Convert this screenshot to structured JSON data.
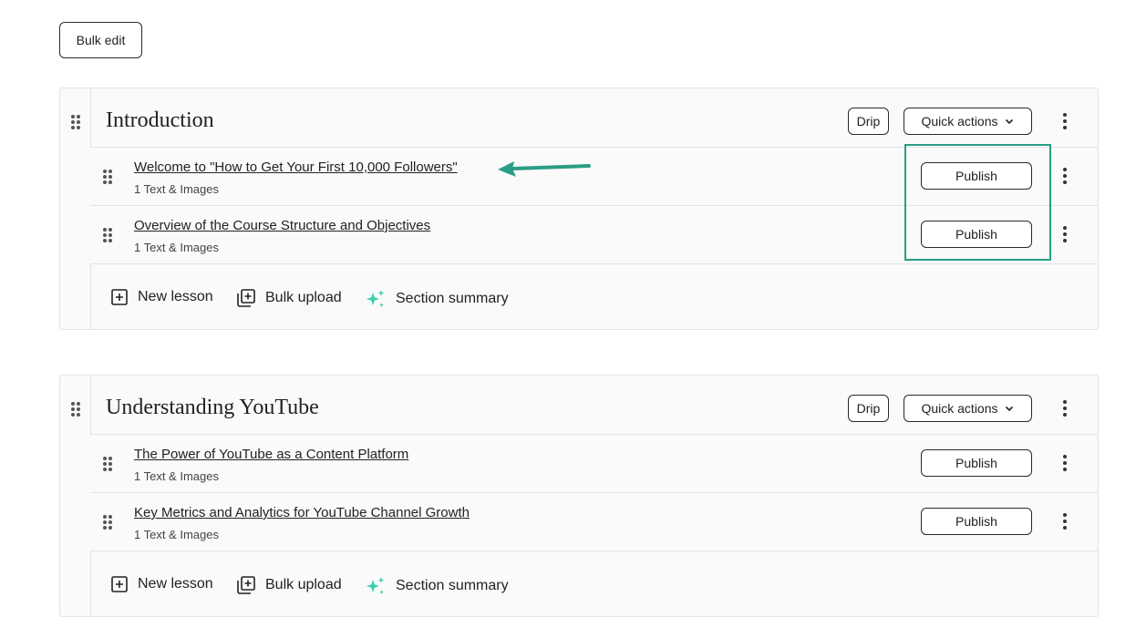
{
  "toolbar": {
    "bulk_edit_label": "Bulk edit"
  },
  "sections": [
    {
      "title": "Introduction",
      "drip_label": "Drip",
      "quick_actions_label": "Quick actions",
      "lessons": [
        {
          "title": "Welcome to \"How to Get Your First 10,000 Followers\"",
          "subtitle": "1 Text & Images",
          "publish_label": "Publish"
        },
        {
          "title": "Overview of the Course Structure and Objectives",
          "subtitle": "1 Text & Images",
          "publish_label": "Publish"
        }
      ],
      "footer": {
        "new_lesson": "New lesson",
        "bulk_upload": "Bulk upload",
        "section_summary": "Section summary"
      }
    },
    {
      "title": "Understanding YouTube",
      "drip_label": "Drip",
      "quick_actions_label": "Quick actions",
      "lessons": [
        {
          "title": "The Power of YouTube as a Content Platform",
          "subtitle": "1 Text & Images",
          "publish_label": "Publish"
        },
        {
          "title": "Key Metrics and Analytics for YouTube Channel Growth",
          "subtitle": "1 Text & Images",
          "publish_label": "Publish"
        }
      ],
      "footer": {
        "new_lesson": "New lesson",
        "bulk_upload": "Bulk upload",
        "section_summary": "Section summary"
      }
    }
  ],
  "colors": {
    "annotation": "#2a9d85",
    "sparkle": "#3ccfb0"
  },
  "icons": [
    "drag-handle-icon",
    "more-vertical-icon",
    "chevron-down-icon",
    "plus-square-icon",
    "bulk-upload-icon",
    "sparkle-icon",
    "arrow-left-icon"
  ]
}
